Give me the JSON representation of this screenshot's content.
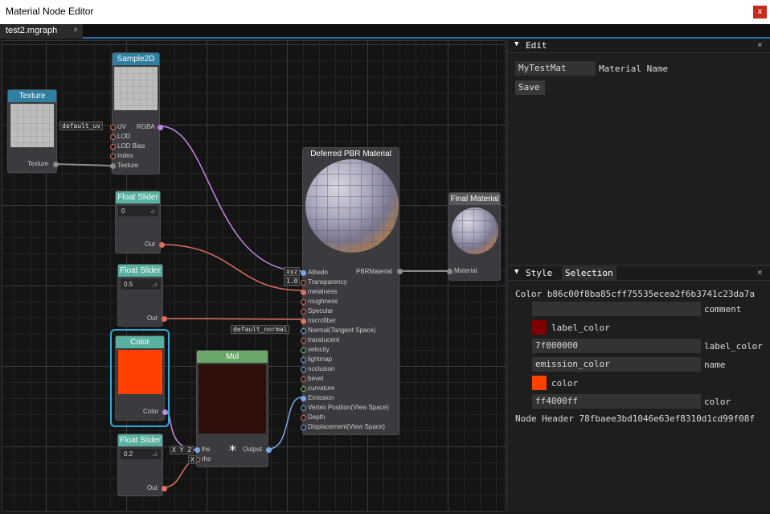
{
  "window": {
    "title": "Material Node Editor",
    "close_label": "x"
  },
  "tabs": [
    {
      "label": "test2.mgraph",
      "close_label": "×"
    }
  ],
  "nodes": {
    "texture": {
      "title": "Texture",
      "out": "Texture"
    },
    "sample2d": {
      "title": "Sample2D",
      "inputs": [
        "UV",
        "LOD",
        "LOD Bias",
        "Index",
        "Texture"
      ],
      "output": "RGBA",
      "uv_tag": "default_uv"
    },
    "float1": {
      "title": "Float Slider",
      "value": "0",
      "out": "Out"
    },
    "float2": {
      "title": "Float Slider",
      "value": "0.5",
      "out": "Out"
    },
    "float3": {
      "title": "Float Slider",
      "value": "0.2",
      "out": "Out"
    },
    "color": {
      "title": "Color",
      "out": "Color",
      "swatch": "#ff4000"
    },
    "mul": {
      "title": "Mul",
      "lhs": "lhs",
      "rhs": "rhs",
      "out": "Output",
      "symbol": "*",
      "lhs_tag": "X Y Z",
      "rhs_tag": "X"
    },
    "pbr": {
      "title": "Deferred PBR Material",
      "inputs": [
        "Albedo",
        "Transparency",
        "metalness",
        "roughness",
        "Specular",
        "microfiber",
        "Normal(Tangent Space)",
        "translucent",
        "velocity",
        "lightmap",
        "occlusion",
        "bevel",
        "curvature",
        "Emission",
        "Vertex Position(View Space)",
        "Depth",
        "Displacement(View Space)"
      ],
      "output": "PBRMaterial",
      "albedo_tag": "xyz",
      "transparency_tag": "1.0",
      "normal_tag": "default_normal"
    },
    "final": {
      "title": "Final Material",
      "input": "Material"
    }
  },
  "edit_panel": {
    "title": "Edit",
    "close_label": "×",
    "material_name_value": "MyTestMat",
    "material_name_label": "Material Name",
    "save_label": "Save"
  },
  "style_panel": {
    "tabs": [
      "Style",
      "Selection"
    ],
    "close_label": "×",
    "color_line": "Color b86c00f8ba85cff75535ecea2f6b3741c23da7a",
    "rows": [
      {
        "value": "",
        "label": "comment"
      },
      {
        "swatch": "#7f0000",
        "text": "label_color"
      },
      {
        "value": "7f000000",
        "label": "label_color"
      },
      {
        "value": "emission_color",
        "label": "name"
      },
      {
        "swatch": "#ff4000",
        "text": "color"
      },
      {
        "value": "ff4000ff",
        "label": "color"
      }
    ],
    "node_header_line": "Node Header 78fbaee3bd1046e63ef8310d1cd99f08f"
  },
  "colors": {
    "accent": "#2a6bb0",
    "selection": "#34a8d8",
    "color_swatch": "#ff4000",
    "label_swatch": "#7f0000"
  }
}
